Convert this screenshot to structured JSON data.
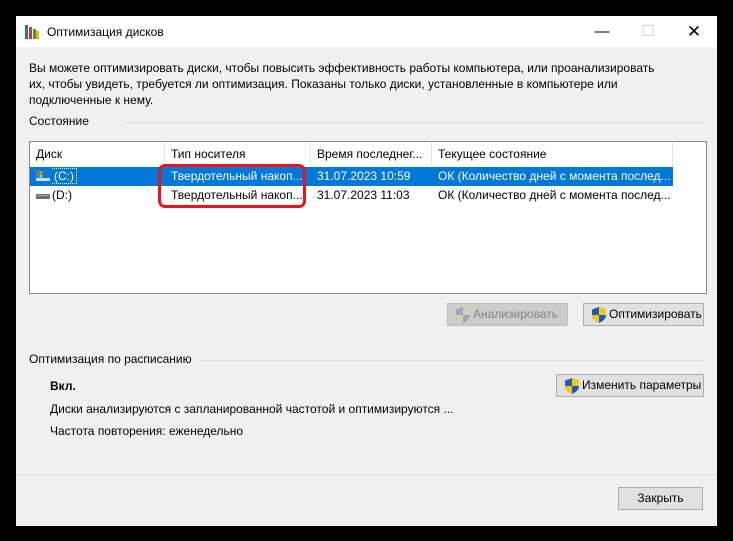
{
  "window": {
    "title": "Оптимизация дисков",
    "minimize_glyph": "—",
    "maximize_glyph": "☐",
    "close_glyph": "✕"
  },
  "description": "Вы можете оптимизировать диски, чтобы повысить эффективность работы  компьютера, или проанализировать\nих, чтобы увидеть, требуется ли оптимизация. Показаны только диски, установленные в компьютере или\nподключенные к нему.",
  "status": {
    "label": "Состояние",
    "columns": [
      "Диск",
      "Тип носителя",
      "Время последнег...",
      "Текущее состояние"
    ],
    "rows": [
      {
        "disk": "(C:)",
        "media": "Твердотельный накоп...",
        "time": "31.07.2023 10:59",
        "state": "ОК (Количество дней с момента послед...",
        "selected": true
      },
      {
        "disk": "(D:)",
        "media": "Твердотельный накоп...",
        "time": "31.07.2023 11:03",
        "state": "ОК (Количество дней с момента послед...",
        "selected": false
      }
    ],
    "analyze_label": "Анализировать",
    "optimize_label": "Оптимизировать"
  },
  "schedule": {
    "label": "Оптимизация по расписанию",
    "state": "Вкл.",
    "info": "Диски анализируются с запланированной частотой и оптимизируются ...",
    "frequency": "Частота повторения: еженедельно",
    "change_label": "Изменить параметры"
  },
  "close_label": "Закрыть",
  "colors": {
    "selection": "#0078d7",
    "highlight": "#e5171d",
    "shield_blue": "#1e5bb8",
    "shield_yellow": "#f2c811"
  }
}
